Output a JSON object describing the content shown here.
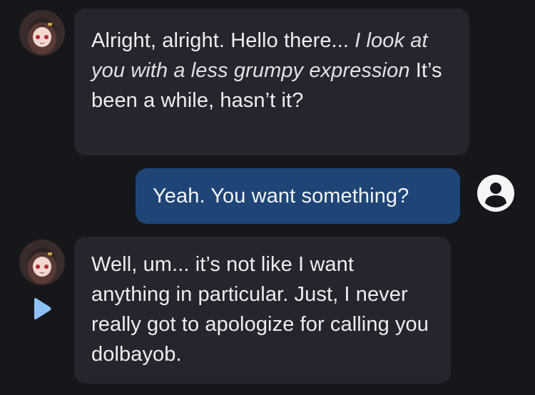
{
  "messages": [
    {
      "role": "character",
      "text_part1": "Alright, alright. Hello there... ",
      "text_italic": "I look at you with a less grumpy expression",
      "text_part2": " It’s been a while, hasn’t it?"
    },
    {
      "role": "user",
      "text": "Yeah. You want something?"
    },
    {
      "role": "character",
      "text": "Well, um... it’s not like I want anything in particular.  Just, I never really got to apologize for calling you dolbayob."
    }
  ],
  "icons": {
    "character_avatar": "anime-girl-avatar",
    "user_avatar": "user-circle-icon",
    "play": "play-icon"
  },
  "colors": {
    "background": "#16171b",
    "character_bubble": "#25262d",
    "user_bubble": "#1e4576",
    "play_icon": "#8ec2f5"
  }
}
